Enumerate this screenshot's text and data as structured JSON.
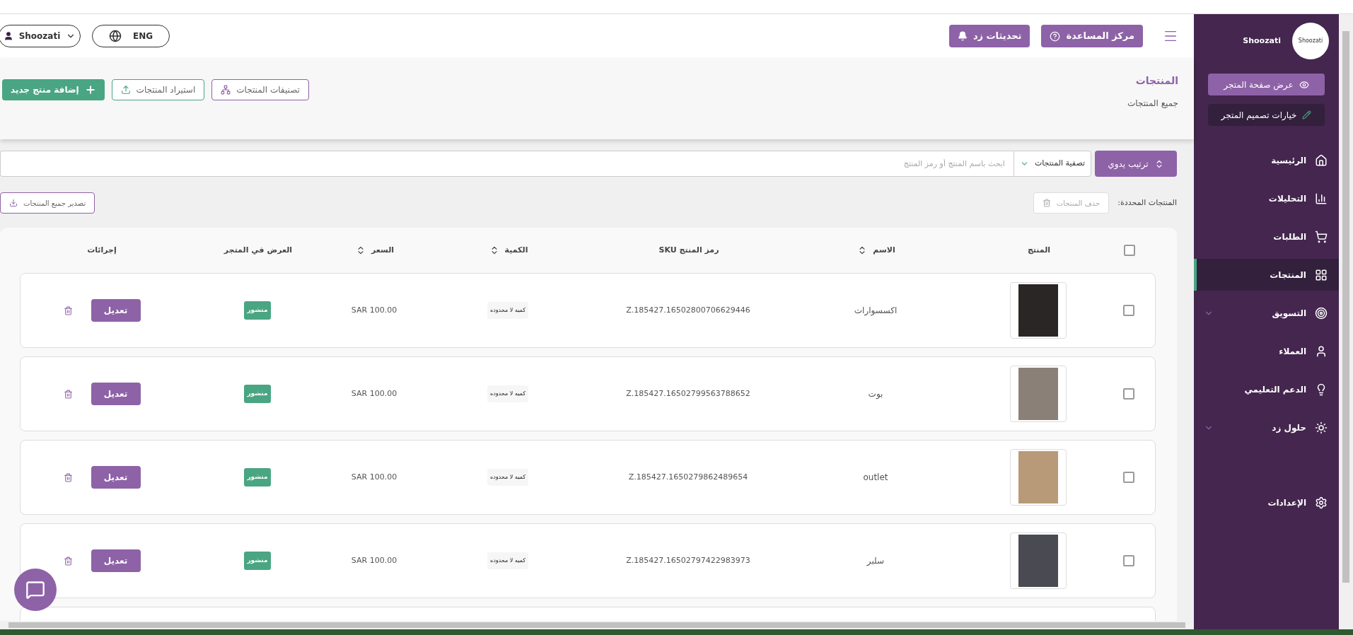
{
  "header": {
    "help_button": "مركز المساعدة",
    "updates_button": "تحديثات زد",
    "account": "Shoozati",
    "language": "ENG"
  },
  "sidebar": {
    "store_name": "Shoozati",
    "logo_text": "Shoozati",
    "view_store_button": "عرض صفحة المتجر",
    "design_button": "خيارات تصميم المتجر",
    "items": [
      {
        "label": "الرئيسية",
        "selected": false,
        "has_submenu": false
      },
      {
        "label": "التحليلات",
        "selected": false,
        "has_submenu": false
      },
      {
        "label": "الطلبات",
        "selected": false,
        "has_submenu": false
      },
      {
        "label": "المنتجات",
        "selected": true,
        "has_submenu": false
      },
      {
        "label": "التسويق",
        "selected": false,
        "has_submenu": true
      },
      {
        "label": "العملاء",
        "selected": false,
        "has_submenu": false
      },
      {
        "label": "الدعم التعليمي",
        "selected": false,
        "has_submenu": false
      },
      {
        "label": "حلول زد",
        "selected": false,
        "has_submenu": true
      },
      {
        "label": "الإعدادات",
        "selected": false,
        "has_submenu": false
      }
    ]
  },
  "page": {
    "title": "المنتجات",
    "breadcrumb": "جميع المنتجات",
    "buttons": [
      {
        "label": "تصنيفات المنتجات",
        "kind": "categories"
      },
      {
        "label": "استيراد المنتجات",
        "kind": "import"
      },
      {
        "label": "إضافة منتج جديد",
        "kind": "add"
      }
    ]
  },
  "toolbar": {
    "sort_button": "ترتيب يدوي",
    "filter": "تصفية المنتجات",
    "search": {
      "placeholder": "ابحث باسم المنتج أو رمز المنتج"
    },
    "selected_label": "المنتجات المحددة:",
    "delete_button": "حذف المنتجات",
    "export_button": "تصدير جميع المنتجات"
  },
  "table": {
    "select_all": {
      "checked": false
    },
    "columns": [
      {
        "label": "المنتج",
        "sortable": false
      },
      {
        "label": "الاسم",
        "sortable": true
      },
      {
        "label": "رمز المنتج SKU",
        "sortable": false
      },
      {
        "label": "الكمية",
        "sortable": true
      },
      {
        "label": "السعر",
        "sortable": true
      },
      {
        "label": "العرض في المتجر",
        "sortable": false
      },
      {
        "label": "إجرائات",
        "sortable": false
      }
    ],
    "rows": [
      {
        "checked": false,
        "name": "اكسسوارات",
        "sku": "Z.185427.16502800706629446",
        "quantity": "كميه لا محدوده",
        "price": "SAR 100.00",
        "status": "منشور",
        "edit": "تعديل"
      },
      {
        "checked": false,
        "name": "بوت",
        "sku": "Z.185427.16502799563788652",
        "quantity": "كميه لا محدوده",
        "price": "SAR 100.00",
        "status": "منشور",
        "edit": "تعديل"
      },
      {
        "checked": false,
        "name": "outlet",
        "sku": "Z.185427.1650279862489654",
        "quantity": "كميه لا محدوده",
        "price": "SAR 100.00",
        "status": "منشور",
        "edit": "تعديل"
      },
      {
        "checked": false,
        "name": "سلبر",
        "sku": "Z.185427.16502797422983973",
        "quantity": "كميه لا محدوده",
        "price": "SAR 100.00",
        "status": "منشور",
        "edit": "تعديل"
      }
    ]
  }
}
